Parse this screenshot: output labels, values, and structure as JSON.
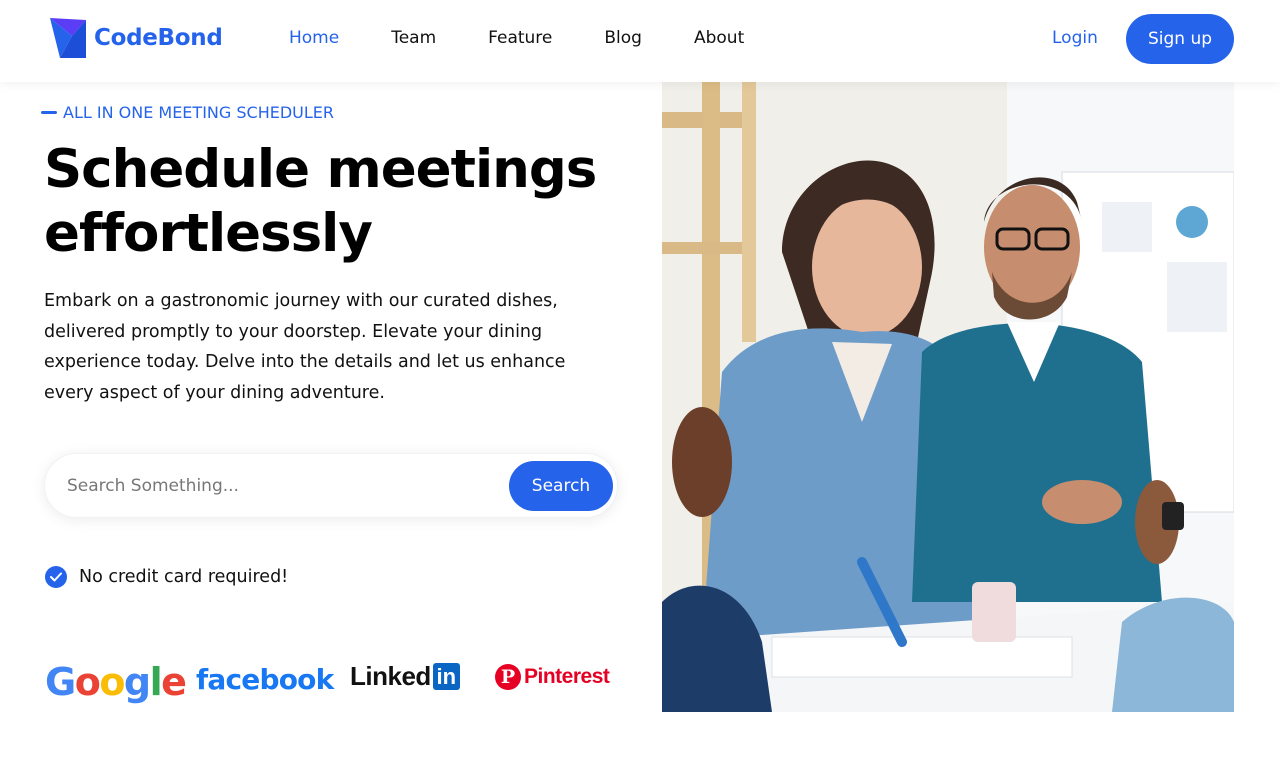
{
  "brand": {
    "name": "CodeBond",
    "logo_icon": "codebond-logo-icon",
    "accent_color": "#2563eb"
  },
  "nav": {
    "items": [
      {
        "label": "Home",
        "active": true
      },
      {
        "label": "Team",
        "active": false
      },
      {
        "label": "Feature",
        "active": false
      },
      {
        "label": "Blog",
        "active": false
      },
      {
        "label": "About",
        "active": false
      }
    ],
    "login_label": "Login",
    "signup_label": "Sign up"
  },
  "hero": {
    "eyebrow": "ALL IN ONE MEETING SCHEDULER",
    "headline_line1": "Schedule meetings",
    "headline_line2": "effortlessly",
    "description": "Embark on a gastronomic journey with our curated dishes, delivered promptly to your doorstep. Elevate your dining experience today. Delve into the details and let us enhance every aspect of your dining adventure.",
    "search": {
      "placeholder": "Search Something...",
      "value": "",
      "button_label": "Search"
    },
    "note": "No credit card required!",
    "brands": {
      "google": "Google",
      "facebook": "facebook",
      "linkedin_word": "Linked",
      "linkedin_box": "in",
      "pinterest_icon": "P",
      "pinterest_word": "Pinterest"
    },
    "image_icon": "team-meeting-photo"
  }
}
